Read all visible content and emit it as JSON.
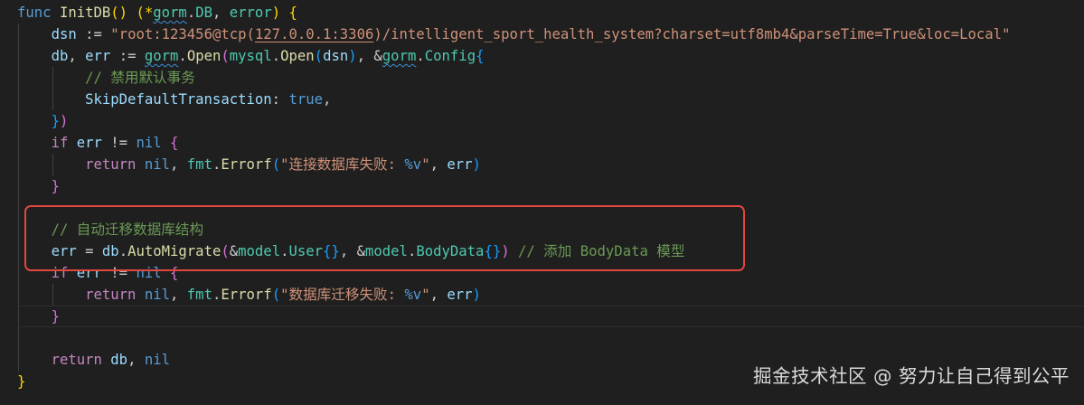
{
  "code": {
    "l1": {
      "a": "func",
      "b": "InitDB",
      "c": "()",
      "d": "(*",
      "e": "gorm",
      "f": ".",
      "g": "DB",
      "h": ",",
      "i": "error",
      "j": ")",
      "k": "{"
    },
    "l2": {
      "a": "dsn",
      "b": ":=",
      "c": "\"root:123456@tcp(",
      "d": "127.0.0.1:3306",
      "e": ")/intelligent_sport_health_system?charset=utf8mb4&parseTime=True&loc=Local\""
    },
    "l3": {
      "a": "db",
      "b": ",",
      "c": "err",
      "d": ":=",
      "e": "gorm",
      "f": ".",
      "g": "Open",
      "h": "(",
      "i": "mysql",
      "j": ".",
      "k": "Open",
      "l": "(",
      "m": "dsn",
      "n": ")",
      "o": ",",
      "p": "&",
      "q": "gorm",
      "r": ".",
      "s": "Config",
      "t": "{"
    },
    "l4": {
      "a": "// 禁用默认事务"
    },
    "l5": {
      "a": "SkipDefaultTransaction",
      "b": ":",
      "c": "true",
      "d": ","
    },
    "l6": {
      "a": "}",
      "b": ")"
    },
    "l7": {
      "a": "if",
      "b": "err",
      "c": "!=",
      "d": "nil",
      "e": "{"
    },
    "l8": {
      "a": "return",
      "b": "nil",
      "c": ",",
      "d": "fmt",
      "e": ".",
      "f": "Errorf",
      "g": "(",
      "h": "\"连接数据库失败: ",
      "i": "%v",
      "j": "\"",
      "k": ",",
      "l": "err",
      "m": ")"
    },
    "l9": {
      "a": "}"
    },
    "l11": {
      "a": "// 自动迁移数据库结构"
    },
    "l12": {
      "a": "err",
      "b": "=",
      "c": "db",
      "d": ".",
      "e": "AutoMigrate",
      "f": "(",
      "g": "&",
      "h": "model",
      "i": ".",
      "j": "User",
      "k": "{}",
      "l": ",",
      "m": "&",
      "n": "model",
      "o": ".",
      "p": "BodyData",
      "q": "{}",
      "r": ")",
      "s": "// 添加 BodyData 模型"
    },
    "l13": {
      "a": "if",
      "b": "err",
      "c": "!=",
      "d": "nil",
      "e": "{"
    },
    "l14": {
      "a": "return",
      "b": "nil",
      "c": ",",
      "d": "fmt",
      "e": ".",
      "f": "Errorf",
      "g": "(",
      "h": "\"数据库迁移失败: ",
      "i": "%v",
      "j": "\"",
      "k": ",",
      "l": "err",
      "m": ")"
    },
    "l15": {
      "a": "}"
    },
    "l17": {
      "a": "return",
      "b": "db",
      "c": ",",
      "d": "nil"
    },
    "l18": {
      "a": "}"
    }
  },
  "watermark": "掘金技术社区 @ 努力让自己得到公平",
  "colors": {
    "background": "#1f1f1f",
    "keyword": "#569cd6",
    "control": "#c586c0",
    "function": "#dcdcaa",
    "type": "#4ec9b0",
    "variable": "#9cdcfe",
    "string": "#ce9178",
    "comment": "#6a9955",
    "highlight_box": "#e0473f"
  }
}
